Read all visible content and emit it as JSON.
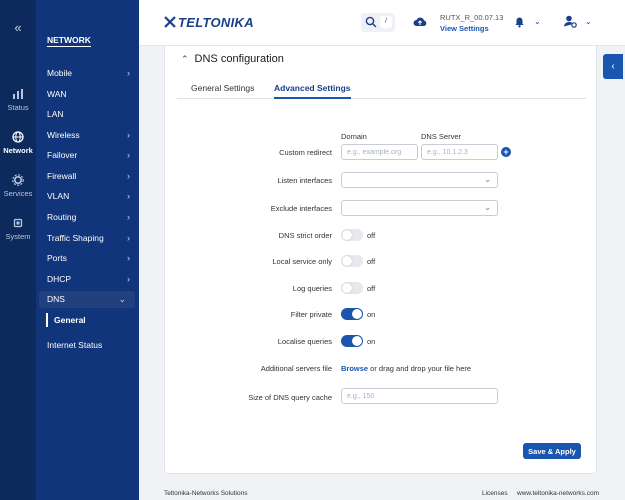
{
  "rail": {
    "collapse_icon": "double-chevron-left-icon",
    "items": [
      {
        "label": "Status",
        "icon": "pulse-icon"
      },
      {
        "label": "Network",
        "icon": "globe-icon"
      },
      {
        "label": "Services",
        "icon": "gear-icon"
      },
      {
        "label": "System",
        "icon": "cpu-icon"
      }
    ]
  },
  "sidebar": {
    "title": "NETWORK",
    "items": [
      {
        "label": "Mobile",
        "chevron": "›"
      },
      {
        "label": "WAN",
        "chevron": ""
      },
      {
        "label": "LAN",
        "chevron": ""
      },
      {
        "label": "Wireless",
        "chevron": "›"
      },
      {
        "label": "Failover",
        "chevron": "›"
      },
      {
        "label": "Firewall",
        "chevron": "›"
      },
      {
        "label": "VLAN",
        "chevron": "›"
      },
      {
        "label": "Routing",
        "chevron": "›"
      },
      {
        "label": "Traffic Shaping",
        "chevron": "›"
      },
      {
        "label": "Ports",
        "chevron": "›"
      },
      {
        "label": "DHCP",
        "chevron": "›"
      },
      {
        "label": "DNS",
        "chevron": "⌄"
      },
      {
        "label": "General",
        "chevron": ""
      },
      {
        "label": "Internet Status",
        "chevron": ""
      }
    ]
  },
  "topbar": {
    "logo": "TELTONIKA",
    "search_shortcut": "/",
    "firmware": "RUTX_R_00.07.13",
    "view_settings": "View Settings"
  },
  "card": {
    "title": "DNS configuration",
    "tabs": [
      "General Settings",
      "Advanced Settings"
    ],
    "active_tab": "Advanced Settings",
    "col_domain": "Domain",
    "col_dns_server": "DNS Server"
  },
  "form": {
    "custom_redirect": {
      "label": "Custom redirect",
      "domain_placeholder": "e.g., example.org",
      "server_placeholder": "e.g., 10.1.2.3"
    },
    "listen_interfaces": {
      "label": "Listen interfaces"
    },
    "exclude_interfaces": {
      "label": "Exclude interfaces"
    },
    "dns_strict_order": {
      "label": "DNS strict order",
      "state": "off"
    },
    "local_service_only": {
      "label": "Local service only",
      "state": "off"
    },
    "log_queries": {
      "label": "Log queries",
      "state": "off"
    },
    "filter_private": {
      "label": "Filter private",
      "state": "on"
    },
    "localise_queries": {
      "label": "Localise queries",
      "state": "on"
    },
    "additional_servers_file": {
      "label": "Additional servers file",
      "browse": "Browse",
      "hint": " or drag and drop your file here"
    },
    "dns_query_cache": {
      "label": "Size of DNS query cache",
      "placeholder": "e.g., 150"
    }
  },
  "save_apply": "Save & Apply",
  "footer": {
    "company": "Teltonika-Networks Solutions",
    "licenses": "Licenses",
    "website": "www.teltonika-networks.com"
  },
  "colors": {
    "rail_bg": "#0d2a5c",
    "sidebar_bg": "#11357a",
    "accent": "#1a56b0"
  }
}
